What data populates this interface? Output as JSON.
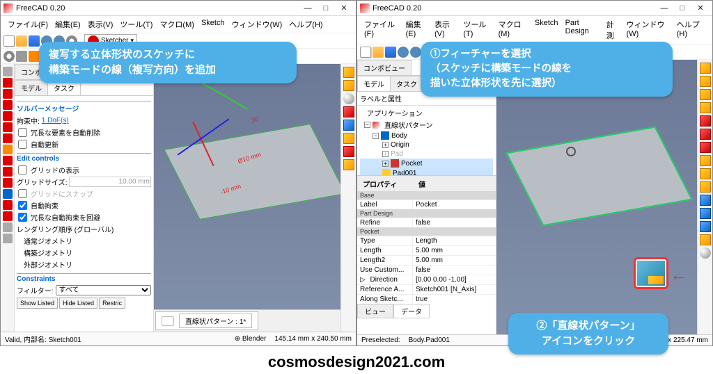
{
  "app1": {
    "title": "FreeCAD 0.20",
    "menu": [
      "ファイル(F)",
      "編集(E)",
      "表示(V)",
      "ツール(T)",
      "マクロ(M)",
      "Sketch",
      "ウィンドウ(W)",
      "ヘルプ(H)"
    ],
    "workbench": "Sketcher",
    "combo": {
      "tabs": [
        "コンボビュー",
        "タスク"
      ],
      "modelTab": "モデル"
    },
    "solver": {
      "header": "ソルバーメッセージ",
      "dofLabel": "拘束中:",
      "dofLink": "1 DoF(s)",
      "autoRemove": "冗長な要素を自動削除",
      "autoUpdate": "自動更新"
    },
    "edit": {
      "header": "Edit controls",
      "showGrid": "グリッドの表示",
      "gridSizeLabel": "グリッドサイズ:",
      "gridSize": "10.00 mm",
      "snapGrid": "グリッドにスナップ",
      "autoConstr": "自動拘束",
      "avoidRedund": "冗長な自動拘束を回避",
      "renderOrder": "レンダリング順序 (グローバル)",
      "geom": [
        "通常ジオメトリ",
        "構築ジオメトリ",
        "外部ジオメトリ"
      ]
    },
    "constraints": {
      "header": "Constraints",
      "filterLabel": "フィルター:",
      "filter": "すべて",
      "showListed": "Show Listed",
      "hideListed": "Hide Listed",
      "restrict": "Restric"
    },
    "viewtab": "直線状パターン : 1*",
    "status": {
      "left": "Valid, 内部名: Sketch001",
      "mid": "Blender",
      "right": "145.14 mm x 240.50 mm"
    },
    "dims": {
      "d1": "Ø10 mm",
      "d2": "-10 mm",
      "ang": "30"
    }
  },
  "app2": {
    "title": "FreeCAD 0.20",
    "menu": [
      "ファイル(F)",
      "編集(E)",
      "表示(V)",
      "ツール(T)",
      "マクロ(M)",
      "Sketch",
      "Part Design",
      "計測",
      "ウィンドウ(W)",
      "ヘルプ(H)"
    ],
    "combo": {
      "tabs": [
        "コンボビュー",
        "タスク"
      ]
    },
    "labels": {
      "labelsAttr": "ラベルと属性",
      "application": "アプリケーション"
    },
    "tree": {
      "root": "直線状パターン",
      "body": "Body",
      "origin": "Origin",
      "pad": "Pad",
      "pocket": "Pocket",
      "pad001": "Pad001"
    },
    "prop": {
      "header": [
        "プロパティ",
        "値"
      ],
      "groups": {
        "base": "Base",
        "partdesign": "Part Design",
        "pocket": "Pocket"
      },
      "rows": [
        [
          "Label",
          "Pocket"
        ],
        [
          "Refine",
          "false"
        ],
        [
          "Type",
          "Length"
        ],
        [
          "Length",
          "5.00 mm"
        ],
        [
          "Length2",
          "5.00 mm"
        ],
        [
          "Use Custom...",
          "false"
        ],
        [
          "Direction",
          "[0.00 0.00 -1.00]"
        ],
        [
          "Reference A...",
          "Sketch001 [N_Axis]"
        ],
        [
          "Along Sketc...",
          "true"
        ]
      ],
      "tabs": [
        "ビュー",
        "データ"
      ]
    },
    "status": {
      "left": "Preselected:",
      "mid": "Body.Pad001",
      "right": "1 mm x 225.47 mm"
    }
  },
  "callouts": {
    "c1a": "複写する立体形状のスケッチに",
    "c1b": "構築モードの線（複写方向）を追加",
    "c2a": "①フィーチャーを選択",
    "c2b": "（スケッチに構築モードの線を",
    "c2c": "描いた立体形状を先に選択）",
    "c3a": "②「直線状パターン」",
    "c3b": "アイコンをクリック"
  },
  "watermark": "cosmosdesign2021.com"
}
